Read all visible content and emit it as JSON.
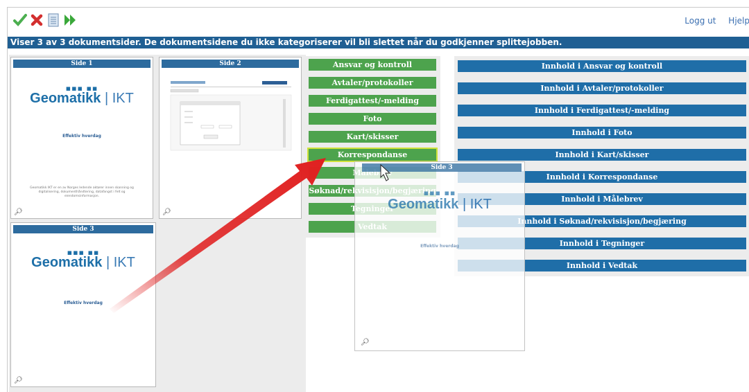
{
  "toolbar": {
    "approve_icon": "check-icon",
    "reject_icon": "x-icon",
    "document_icon": "document-icon",
    "forward_icon": "fast-forward-icon",
    "colors": {
      "check": "#4caf50",
      "x": "#d32f2f",
      "forward": "#3aa83a"
    }
  },
  "header_links": {
    "logout": "Logg ut",
    "help": "Hjelp"
  },
  "infobar": {
    "text": "Viser 3 av 3 dokumentsider. De dokumentsidene du ikke kategoriserer vil bli slettet når du godkjenner splittejobben."
  },
  "pages": [
    {
      "title": "Side 1",
      "logo_main": "Geomatikk",
      "logo_suffix": "IKT",
      "tagline": "Effektiv hverdag",
      "footer": "Geomatikk IKT er en av Norges ledende aktører innen skanning og digitalisering, dokumenthåndtering, datafangst i felt og eiendomsinformasjon."
    },
    {
      "title": "Side 2"
    },
    {
      "title": "Side 3",
      "logo_main": "Geomatikk",
      "logo_suffix": "IKT",
      "tagline": "Effektiv hverdag"
    }
  ],
  "categories": [
    "Ansvar og kontroll",
    "Avtaler/protokoller",
    "Ferdigattest/-melding",
    "Foto",
    "Kart/skisser",
    "Korrespondanse",
    "Målebrev",
    "Søknad/rekvisisjon/begjæring",
    "Tegninger",
    "Vedtak"
  ],
  "selected_category": "Korrespondanse",
  "contents": [
    "Innhold i Ansvar og kontroll",
    "Innhold i Avtaler/protokoller",
    "Innhold i Ferdigattest/-melding",
    "Innhold i Foto",
    "Innhold i Kart/skisser",
    "Innhold i Korrespondanse",
    "Innhold i Målebrev",
    "Innhold i Søknad/rekvisisjon/begjæring",
    "Innhold i Tegninger",
    "Innhold i Vedtak"
  ],
  "dragged": {
    "title": "Side 3",
    "logo_main": "Geomatikk",
    "logo_suffix": "IKT",
    "tagline": "Effektiv hverdag"
  },
  "zoom_icon": "magnifier-icon",
  "colors": {
    "infobar": "#1f5f93",
    "category": "#4da34d",
    "content": "#1f6ea8",
    "arrow": "#e02020",
    "highlight": "#cfe23a"
  }
}
